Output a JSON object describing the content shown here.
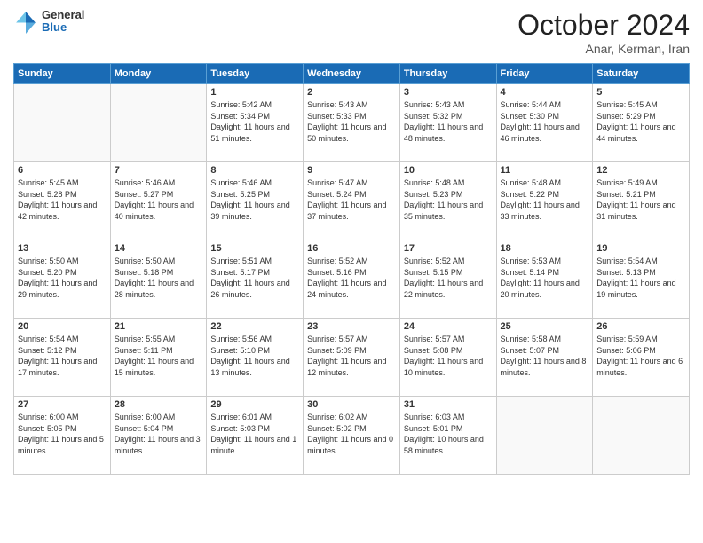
{
  "header": {
    "logo": {
      "general": "General",
      "blue": "Blue"
    },
    "title": "October 2024",
    "subtitle": "Anar, Kerman, Iran"
  },
  "weekdays": [
    "Sunday",
    "Monday",
    "Tuesday",
    "Wednesday",
    "Thursday",
    "Friday",
    "Saturday"
  ],
  "weeks": [
    [
      {
        "day": null,
        "sunrise": null,
        "sunset": null,
        "daylight": null
      },
      {
        "day": null,
        "sunrise": null,
        "sunset": null,
        "daylight": null
      },
      {
        "day": "1",
        "sunrise": "Sunrise: 5:42 AM",
        "sunset": "Sunset: 5:34 PM",
        "daylight": "Daylight: 11 hours and 51 minutes."
      },
      {
        "day": "2",
        "sunrise": "Sunrise: 5:43 AM",
        "sunset": "Sunset: 5:33 PM",
        "daylight": "Daylight: 11 hours and 50 minutes."
      },
      {
        "day": "3",
        "sunrise": "Sunrise: 5:43 AM",
        "sunset": "Sunset: 5:32 PM",
        "daylight": "Daylight: 11 hours and 48 minutes."
      },
      {
        "day": "4",
        "sunrise": "Sunrise: 5:44 AM",
        "sunset": "Sunset: 5:30 PM",
        "daylight": "Daylight: 11 hours and 46 minutes."
      },
      {
        "day": "5",
        "sunrise": "Sunrise: 5:45 AM",
        "sunset": "Sunset: 5:29 PM",
        "daylight": "Daylight: 11 hours and 44 minutes."
      }
    ],
    [
      {
        "day": "6",
        "sunrise": "Sunrise: 5:45 AM",
        "sunset": "Sunset: 5:28 PM",
        "daylight": "Daylight: 11 hours and 42 minutes."
      },
      {
        "day": "7",
        "sunrise": "Sunrise: 5:46 AM",
        "sunset": "Sunset: 5:27 PM",
        "daylight": "Daylight: 11 hours and 40 minutes."
      },
      {
        "day": "8",
        "sunrise": "Sunrise: 5:46 AM",
        "sunset": "Sunset: 5:25 PM",
        "daylight": "Daylight: 11 hours and 39 minutes."
      },
      {
        "day": "9",
        "sunrise": "Sunrise: 5:47 AM",
        "sunset": "Sunset: 5:24 PM",
        "daylight": "Daylight: 11 hours and 37 minutes."
      },
      {
        "day": "10",
        "sunrise": "Sunrise: 5:48 AM",
        "sunset": "Sunset: 5:23 PM",
        "daylight": "Daylight: 11 hours and 35 minutes."
      },
      {
        "day": "11",
        "sunrise": "Sunrise: 5:48 AM",
        "sunset": "Sunset: 5:22 PM",
        "daylight": "Daylight: 11 hours and 33 minutes."
      },
      {
        "day": "12",
        "sunrise": "Sunrise: 5:49 AM",
        "sunset": "Sunset: 5:21 PM",
        "daylight": "Daylight: 11 hours and 31 minutes."
      }
    ],
    [
      {
        "day": "13",
        "sunrise": "Sunrise: 5:50 AM",
        "sunset": "Sunset: 5:20 PM",
        "daylight": "Daylight: 11 hours and 29 minutes."
      },
      {
        "day": "14",
        "sunrise": "Sunrise: 5:50 AM",
        "sunset": "Sunset: 5:18 PM",
        "daylight": "Daylight: 11 hours and 28 minutes."
      },
      {
        "day": "15",
        "sunrise": "Sunrise: 5:51 AM",
        "sunset": "Sunset: 5:17 PM",
        "daylight": "Daylight: 11 hours and 26 minutes."
      },
      {
        "day": "16",
        "sunrise": "Sunrise: 5:52 AM",
        "sunset": "Sunset: 5:16 PM",
        "daylight": "Daylight: 11 hours and 24 minutes."
      },
      {
        "day": "17",
        "sunrise": "Sunrise: 5:52 AM",
        "sunset": "Sunset: 5:15 PM",
        "daylight": "Daylight: 11 hours and 22 minutes."
      },
      {
        "day": "18",
        "sunrise": "Sunrise: 5:53 AM",
        "sunset": "Sunset: 5:14 PM",
        "daylight": "Daylight: 11 hours and 20 minutes."
      },
      {
        "day": "19",
        "sunrise": "Sunrise: 5:54 AM",
        "sunset": "Sunset: 5:13 PM",
        "daylight": "Daylight: 11 hours and 19 minutes."
      }
    ],
    [
      {
        "day": "20",
        "sunrise": "Sunrise: 5:54 AM",
        "sunset": "Sunset: 5:12 PM",
        "daylight": "Daylight: 11 hours and 17 minutes."
      },
      {
        "day": "21",
        "sunrise": "Sunrise: 5:55 AM",
        "sunset": "Sunset: 5:11 PM",
        "daylight": "Daylight: 11 hours and 15 minutes."
      },
      {
        "day": "22",
        "sunrise": "Sunrise: 5:56 AM",
        "sunset": "Sunset: 5:10 PM",
        "daylight": "Daylight: 11 hours and 13 minutes."
      },
      {
        "day": "23",
        "sunrise": "Sunrise: 5:57 AM",
        "sunset": "Sunset: 5:09 PM",
        "daylight": "Daylight: 11 hours and 12 minutes."
      },
      {
        "day": "24",
        "sunrise": "Sunrise: 5:57 AM",
        "sunset": "Sunset: 5:08 PM",
        "daylight": "Daylight: 11 hours and 10 minutes."
      },
      {
        "day": "25",
        "sunrise": "Sunrise: 5:58 AM",
        "sunset": "Sunset: 5:07 PM",
        "daylight": "Daylight: 11 hours and 8 minutes."
      },
      {
        "day": "26",
        "sunrise": "Sunrise: 5:59 AM",
        "sunset": "Sunset: 5:06 PM",
        "daylight": "Daylight: 11 hours and 6 minutes."
      }
    ],
    [
      {
        "day": "27",
        "sunrise": "Sunrise: 6:00 AM",
        "sunset": "Sunset: 5:05 PM",
        "daylight": "Daylight: 11 hours and 5 minutes."
      },
      {
        "day": "28",
        "sunrise": "Sunrise: 6:00 AM",
        "sunset": "Sunset: 5:04 PM",
        "daylight": "Daylight: 11 hours and 3 minutes."
      },
      {
        "day": "29",
        "sunrise": "Sunrise: 6:01 AM",
        "sunset": "Sunset: 5:03 PM",
        "daylight": "Daylight: 11 hours and 1 minute."
      },
      {
        "day": "30",
        "sunrise": "Sunrise: 6:02 AM",
        "sunset": "Sunset: 5:02 PM",
        "daylight": "Daylight: 11 hours and 0 minutes."
      },
      {
        "day": "31",
        "sunrise": "Sunrise: 6:03 AM",
        "sunset": "Sunset: 5:01 PM",
        "daylight": "Daylight: 10 hours and 58 minutes."
      },
      {
        "day": null,
        "sunrise": null,
        "sunset": null,
        "daylight": null
      },
      {
        "day": null,
        "sunrise": null,
        "sunset": null,
        "daylight": null
      }
    ]
  ]
}
